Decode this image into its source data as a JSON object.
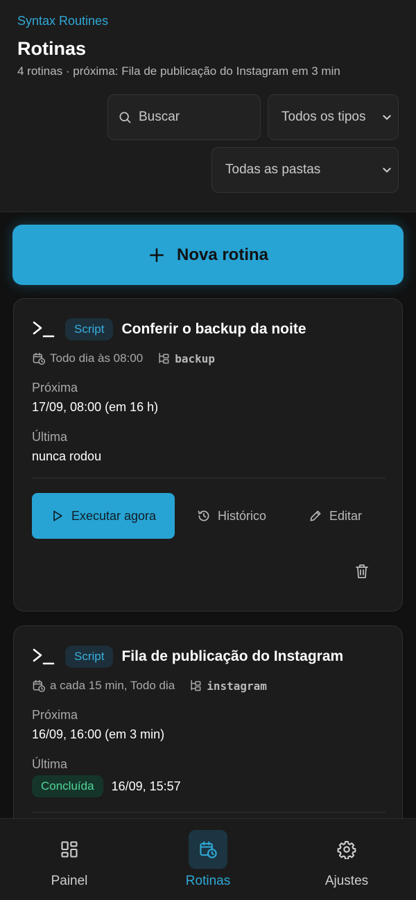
{
  "header": {
    "brand": "Syntax Routines",
    "title": "Rotinas",
    "subtitle": "4 rotinas · próxima: Fila de publicação do Instagram em 3 min",
    "search_placeholder": "Buscar",
    "type_filter": "Todos os tipos",
    "folder_filter": "Todas as pastas"
  },
  "new_button": {
    "label": "Nova rotina"
  },
  "routines": [
    {
      "type": "Script",
      "title": "Conferir o backup da noite",
      "schedule": "Todo dia às 08:00",
      "folder": "backup",
      "next_label": "Próxima",
      "next_value": "17/09, 08:00 (em 16 h)",
      "last_label": "Última",
      "last_value": "nunca rodou",
      "run_label": "Executar agora",
      "history_label": "Histórico",
      "edit_label": "Editar"
    },
    {
      "type": "Script",
      "title": "Fila de publicação do Instagram",
      "schedule": "a cada 15 min, Todo dia",
      "folder": "instagram",
      "next_label": "Próxima",
      "next_value": "16/09, 16:00 (em 3 min)",
      "last_label": "Última",
      "last_status": "Concluída",
      "last_value": "16/09, 15:57"
    }
  ],
  "nav": {
    "items": [
      {
        "label": "Painel",
        "icon": "dashboard-icon"
      },
      {
        "label": "Rotinas",
        "icon": "calendar-clock-icon",
        "active": true
      },
      {
        "label": "Ajustes",
        "icon": "gear-icon"
      }
    ]
  },
  "colors": {
    "accent": "#27a4d4",
    "background": "#111111",
    "card": "#1c1c1c",
    "success": "#4fd69a"
  }
}
